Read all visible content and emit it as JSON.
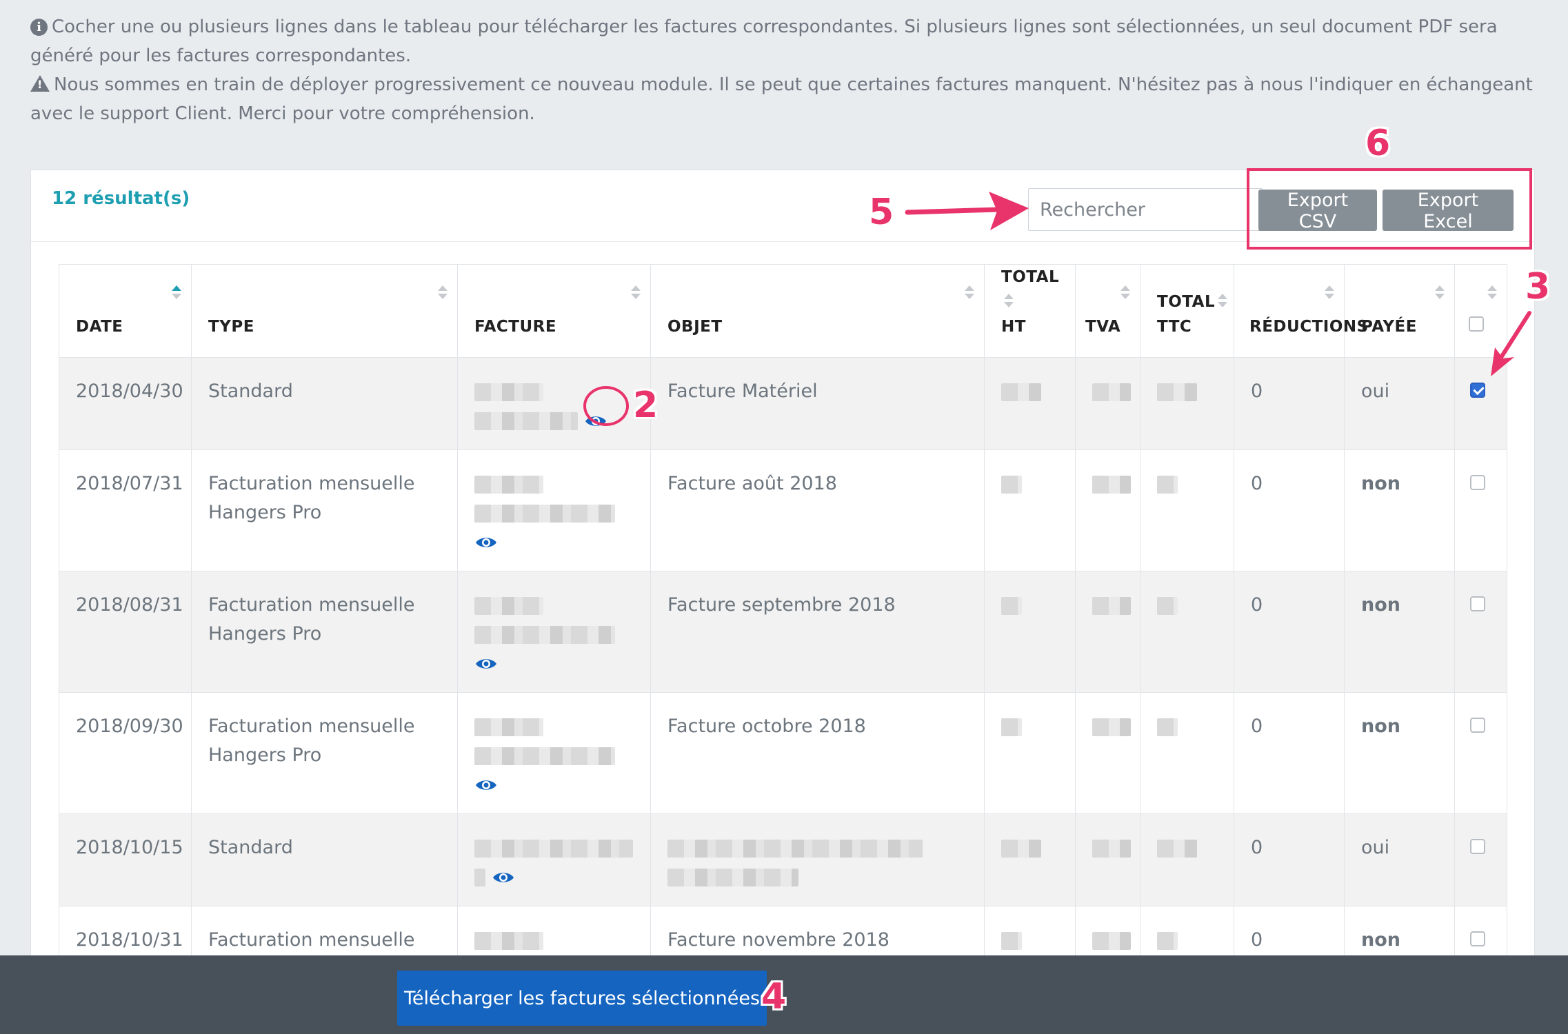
{
  "info": {
    "line1": "Cocher une ou plusieurs lignes dans le tableau pour télécharger les factures correspondantes. Si plusieurs lignes sont sélectionnées, un seul document PDF sera généré pour les factures correspondantes.",
    "line2": "Nous sommes en train de déployer progressivement ce nouveau module. Il se peut que certaines factures manquent. N'hésitez pas à nous l'indiquer en échangeant avec le support Client. Merci pour votre compréhension."
  },
  "header": {
    "results": "12 résultat(s)",
    "search_placeholder": "Rechercher",
    "export_csv": "Export CSV",
    "export_excel": "Export Excel"
  },
  "table": {
    "columns": {
      "date": "DATE",
      "type": "TYPE",
      "facture": "FACTURE",
      "objet": "OBJET",
      "total_ht_1": "TOTAL",
      "total_ht_2": "HT",
      "tva": "TVA",
      "total_ttc_1": "TOTAL",
      "total_ttc_2": "TTC",
      "reductions": "RÉDUCTIONS",
      "payee": "PAYÉE"
    },
    "rows": [
      {
        "date": "2018/04/30",
        "type": "Standard",
        "objet": "Facture Matériel",
        "reductions": "0",
        "payee": "oui",
        "checked": true
      },
      {
        "date": "2018/07/31",
        "type": "Facturation mensuelle Hangers Pro",
        "objet": "Facture août 2018",
        "reductions": "0",
        "payee": "non",
        "checked": false
      },
      {
        "date": "2018/08/31",
        "type": "Facturation mensuelle Hangers Pro",
        "objet": "Facture septembre 2018",
        "reductions": "0",
        "payee": "non",
        "checked": false
      },
      {
        "date": "2018/09/30",
        "type": "Facturation mensuelle Hangers Pro",
        "objet": "Facture octobre 2018",
        "reductions": "0",
        "payee": "non",
        "checked": false
      },
      {
        "date": "2018/10/15",
        "type": "Standard",
        "objet": "",
        "reductions": "0",
        "payee": "oui",
        "checked": false
      },
      {
        "date": "2018/10/31",
        "type": "Facturation mensuelle Hangers Pro",
        "objet": "Facture novembre 2018",
        "reductions": "0",
        "payee": "non",
        "checked": false
      }
    ]
  },
  "footer": {
    "download_button": "Télécharger les factures sélectionnées"
  },
  "annotations": {
    "n2": "2",
    "n3": "3",
    "n4": "4",
    "n5": "5",
    "n6": "6"
  },
  "colors": {
    "accent": "#1e9fb1",
    "primary_button": "#1565c0",
    "annotation": "#e8336b",
    "footer_bg": "#48505a"
  }
}
